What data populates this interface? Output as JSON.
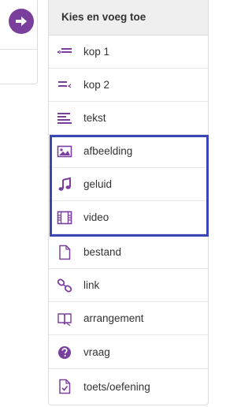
{
  "panel": {
    "title": "Kies en voeg toe",
    "items": [
      {
        "label": "kop 1",
        "icon": "heading-1-icon"
      },
      {
        "label": "kop 2",
        "icon": "heading-2-icon"
      },
      {
        "label": "tekst",
        "icon": "text-icon"
      },
      {
        "label": "afbeelding",
        "icon": "image-icon"
      },
      {
        "label": "geluid",
        "icon": "music-note-icon"
      },
      {
        "label": "video",
        "icon": "film-icon"
      },
      {
        "label": "bestand",
        "icon": "file-icon"
      },
      {
        "label": "link",
        "icon": "link-icon"
      },
      {
        "label": "arrangement",
        "icon": "book-icon"
      },
      {
        "label": "vraag",
        "icon": "question-icon"
      },
      {
        "label": "toets/oefening",
        "icon": "checklist-icon"
      }
    ]
  },
  "colors": {
    "accent": "#7a3e9d",
    "highlight_border": "#3b45b6",
    "header_bg": "#efefef"
  }
}
